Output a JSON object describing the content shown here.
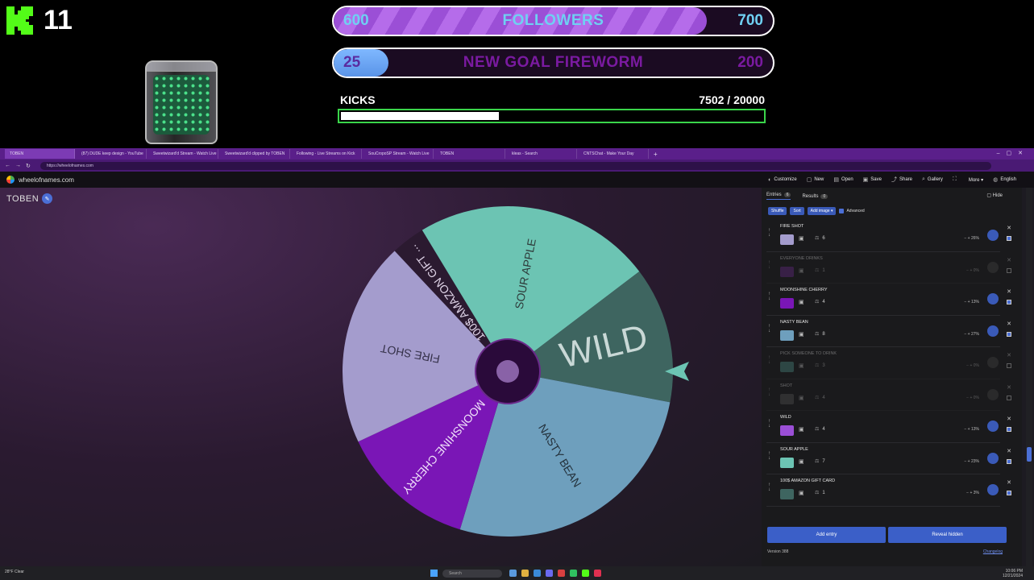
{
  "overlay": {
    "kick_count": "11",
    "followers": {
      "left": "600",
      "label": "FOLLOWERS",
      "right": "700",
      "fill_fraction": 0.85
    },
    "goal": {
      "left": "25",
      "label": "NEW GOAL FIREWORM",
      "right": "200",
      "fill_fraction": 0.125
    },
    "kicks": {
      "label": "KICKS",
      "value": "7502  / 20000",
      "fill_fraction": 0.375
    },
    "colors": {
      "kick_green": "#53fc18",
      "purple": "#9b4fd6",
      "cyan": "#6fd0f2",
      "bar_border": "#3ad54a"
    }
  },
  "browser": {
    "tabs": [
      "TOBEN",
      "(87) DUDE keep design - YouTube",
      "Sweetwizard'd Stream - Watch Live",
      "Sweetwizard'd clipped by TOBEN",
      "Following - Live Streams on Kick",
      "SouCropoSP Stream - Watch Live",
      "TOBEN",
      "kleas - Search",
      "CNTSChat - Make Your Day"
    ],
    "active_tab_index": 0,
    "url": "https://wheelofnames.com",
    "site_name": "wheelofnames.com",
    "menu": [
      {
        "icon": "palette-icon",
        "glyph": "◐",
        "label": "Customize"
      },
      {
        "icon": "file-icon",
        "glyph": "▢",
        "label": "New"
      },
      {
        "icon": "folder-icon",
        "glyph": "▤",
        "label": "Open"
      },
      {
        "icon": "save-icon",
        "glyph": "▣",
        "label": "Save"
      },
      {
        "icon": "share-icon",
        "glyph": "⤴",
        "label": "Share"
      },
      {
        "icon": "search-icon",
        "glyph": "⌕",
        "label": "Gallery"
      },
      {
        "icon": "fullscreen-icon",
        "glyph": "⛶",
        "label": ""
      },
      {
        "icon": "more-icon",
        "glyph": "",
        "label": "More ▾"
      },
      {
        "icon": "globe-icon",
        "glyph": "◍",
        "label": "English"
      }
    ]
  },
  "wheel": {
    "title": "TOBEN",
    "segments": [
      {
        "label": "100$ AMAZON GIFT ...",
        "weight": 1,
        "color": "#2b1a30",
        "text_color": "#e0d4e8"
      },
      {
        "label": "SOUR APPLE",
        "weight": 7,
        "color": "#6cc4b3",
        "text_color": "#2e3b3a"
      },
      {
        "label": "WILD",
        "weight": 4,
        "color": "#3e6560",
        "text_color": "#c9d8d6"
      },
      {
        "label": "NASTY BEAN",
        "weight": 8,
        "color": "#6e9fbd",
        "text_color": "#23303a"
      },
      {
        "label": "MOONSHINE CHERRY",
        "weight": 4,
        "color": "#7a16b6",
        "text_color": "#f0e2fa"
      },
      {
        "label": "FIRE SHOT",
        "weight": 6,
        "color": "#a49ccd",
        "text_color": "#343048"
      }
    ],
    "pointer_color": "#6cc4b3"
  },
  "panel": {
    "tabs": [
      {
        "label": "Entries",
        "badge": "6"
      },
      {
        "label": "Results",
        "badge": "0"
      }
    ],
    "hide_label": "Hide",
    "toolbar": {
      "shuffle": "Shuffle",
      "sort": "Sort",
      "add_image": "Add image ▾",
      "advanced": "Advanced"
    },
    "entries": [
      {
        "name": "FIRE SHOT",
        "weight": "6",
        "pct": "26%",
        "color": "#a49ccd",
        "enabled": true
      },
      {
        "name": "EVERYONE DRINKS",
        "weight": "1",
        "pct": "0%",
        "color": "#6a2a8a",
        "enabled": false
      },
      {
        "name": "MOONSHINE CHERRY",
        "weight": "4",
        "pct": "13%",
        "color": "#7a16b6",
        "enabled": true
      },
      {
        "name": "NASTY BEAN",
        "weight": "8",
        "pct": "27%",
        "color": "#6e9fbd",
        "enabled": true
      },
      {
        "name": "PICK SOMEONE TO DRINK",
        "weight": "3",
        "pct": "0%",
        "color": "#4d8f86",
        "enabled": false
      },
      {
        "name": "SHOT",
        "weight": "4",
        "pct": "0%",
        "color": "#555",
        "enabled": false
      },
      {
        "name": "WILD",
        "weight": "4",
        "pct": "13%",
        "color": "#9b4fd6",
        "enabled": true
      },
      {
        "name": "SOUR APPLE",
        "weight": "7",
        "pct": "23%",
        "color": "#6cc4b3",
        "enabled": true
      },
      {
        "name": "100$ AMAZON GIFT CARD",
        "weight": "1",
        "pct": "3%",
        "color": "#3e6560",
        "enabled": true
      }
    ],
    "add_entry": "Add entry",
    "reveal_hidden": "Reveal hidden",
    "version": "Version 388",
    "changelog": "Changelog"
  },
  "taskbar": {
    "weather": "28°F Clear",
    "search_placeholder": "Search",
    "clock_time": "10:06 PM",
    "clock_date": "12/21/2024"
  }
}
